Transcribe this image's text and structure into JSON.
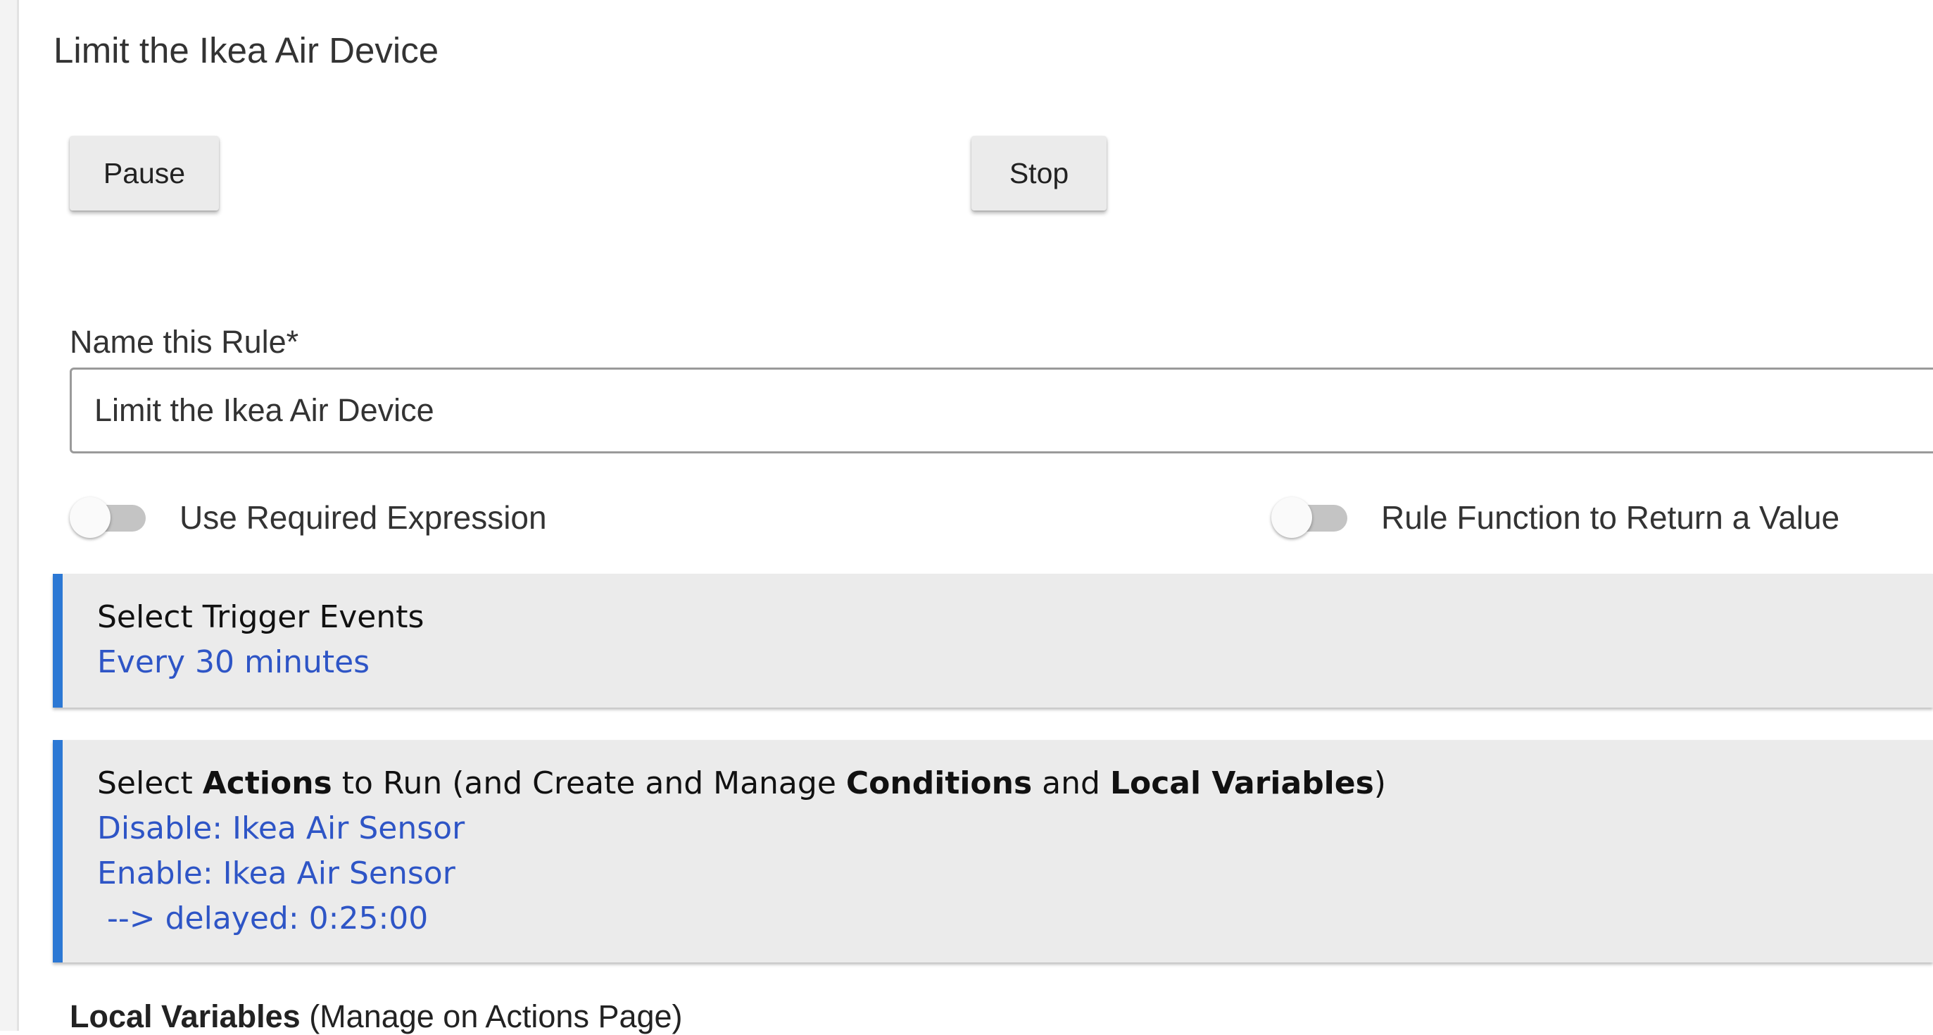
{
  "page": {
    "title": "Limit the Ikea Air Device"
  },
  "controls": {
    "pause_label": "Pause",
    "stop_label": "Stop"
  },
  "rule_name": {
    "label": "Name this Rule*",
    "value": "Limit the Ikea Air Device"
  },
  "toggles": {
    "required_expression": {
      "label": "Use Required Expression",
      "on": false
    },
    "return_value": {
      "label": "Rule Function to Return a Value",
      "on": false
    }
  },
  "trigger_section": {
    "heading": "Select Trigger Events",
    "items": [
      "Every 30 minutes"
    ]
  },
  "actions_section": {
    "heading_parts": [
      {
        "text": "Select ",
        "bold": false
      },
      {
        "text": "Actions",
        "bold": true
      },
      {
        "text": " to Run (and Create and Manage ",
        "bold": false
      },
      {
        "text": "Conditions",
        "bold": true
      },
      {
        "text": " and ",
        "bold": false
      },
      {
        "text": "Local Variables",
        "bold": true
      },
      {
        "text": ")",
        "bold": false
      }
    ],
    "items": [
      "Disable: Ikea Air Sensor",
      "Enable: Ikea Air Sensor",
      " --> delayed: 0:25:00"
    ]
  },
  "local_variables": {
    "title": "Local Variables",
    "note": " (Manage on Actions Page)"
  },
  "colors": {
    "accent_bar": "#2c78d4",
    "link": "#2e55c6",
    "section_bg": "#ebebeb",
    "button_bg": "#ebebeb"
  }
}
